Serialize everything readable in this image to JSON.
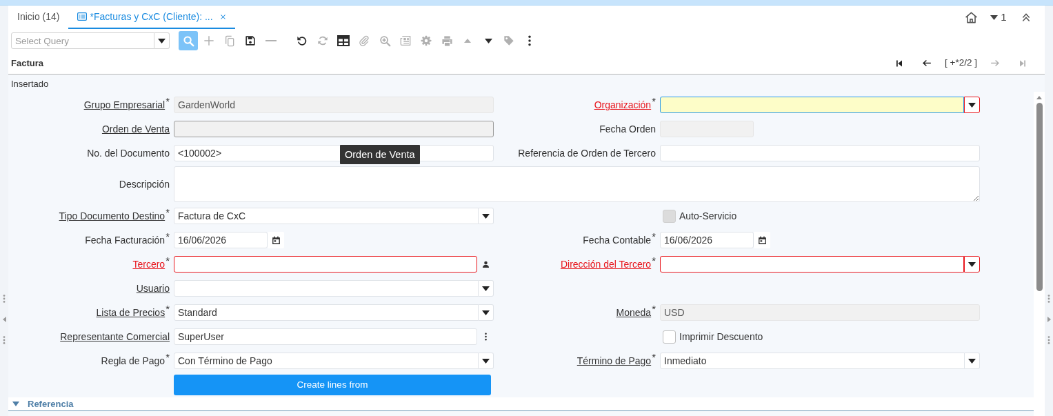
{
  "tabs": [
    {
      "kind": "home",
      "label": "Inicio (14)",
      "selected": false
    },
    {
      "kind": "window",
      "label": "*Facturas y CxC (Cliente): ...",
      "selected": true
    }
  ],
  "window_actions": {
    "count": "1"
  },
  "toolbar": {
    "query": {
      "placeholder": "Select Query"
    },
    "groups": [
      [
        {
          "kind": "search",
          "disabled": false
        },
        {
          "kind": "new",
          "disabled": true
        },
        {
          "kind": "copy",
          "disabled": true
        },
        {
          "kind": "save",
          "disabled": false
        },
        {
          "kind": "delete",
          "disabled": true
        }
      ],
      [
        {
          "kind": "undo",
          "disabled": false
        },
        {
          "kind": "refresh",
          "disabled": true
        },
        {
          "kind": "grid",
          "disabled": false
        },
        {
          "kind": "attachment",
          "disabled": true
        },
        {
          "kind": "zoom",
          "disabled": true
        },
        {
          "kind": "report",
          "disabled": true
        },
        {
          "kind": "settings",
          "disabled": true
        },
        {
          "kind": "print",
          "disabled": true
        },
        {
          "kind": "up",
          "disabled": true
        },
        {
          "kind": "down",
          "disabled": false
        },
        {
          "kind": "tag",
          "disabled": true
        },
        {
          "kind": "more",
          "disabled": false
        }
      ]
    ]
  },
  "panel": {
    "title": "Factura",
    "nav": {
      "back": [
        {
          "kind": "first",
          "disabled": false
        },
        {
          "kind": "previous",
          "disabled": false
        }
      ],
      "position": "[ +*2/2 ]",
      "forward": [
        {
          "kind": "next",
          "disabled": true
        },
        {
          "kind": "last",
          "disabled": true
        }
      ]
    }
  },
  "form": {
    "status": "Insertado",
    "rows": [
      {
        "left": {
          "kind": "text",
          "label": "Grupo Empresarial$^{*}$",
          "link": true,
          "readonly": true,
          "error": false,
          "value": "GardenWorld"
        },
        "right": {
          "kind": "select",
          "label": "Organización$^{*}$",
          "link": true,
          "readonly": false,
          "error": true,
          "focused": true
        }
      },
      {
        "left": {
          "kind": "text",
          "label": "Orden de Venta",
          "link": true,
          "readonly": true,
          "error": false,
          "hovered": true
        },
        "right": {
          "kind": "date",
          "label": "Fecha Orden",
          "link": false,
          "readonly": true,
          "error": false
        }
      },
      {
        "left": {
          "kind": "text",
          "label": "No. del Documento",
          "link": false,
          "readonly": false,
          "error": false,
          "value": "<100002>"
        },
        "right": {
          "kind": "text",
          "label": "Referencia de Orden de Tercero",
          "link": false,
          "readonly": false,
          "error": false
        }
      },
      {
        "left": {
          "kind": "textarea",
          "label": "Descripción",
          "link": false,
          "readonly": false,
          "error": false
        }
      },
      {
        "left": {
          "kind": "select",
          "label": "Tipo Documento Destino$^{*}$",
          "link": true,
          "readonly": false,
          "error": false,
          "value": "Factura de CxC"
        },
        "right": {
          "kind": "checkbox",
          "label": "Auto-Servicio",
          "checked": false,
          "disabled": true
        }
      },
      {
        "left": {
          "kind": "date",
          "label": "Fecha Facturación$^{*}$",
          "link": false,
          "readonly": false,
          "error": false,
          "value": "16/06/2026"
        },
        "right": {
          "kind": "date",
          "label": "Fecha Contable$^{*}$",
          "link": false,
          "readonly": false,
          "error": false,
          "value": "16/06/2026"
        }
      },
      {
        "left": {
          "kind": "search",
          "label": "Tercero$^{*}$",
          "link": true,
          "readonly": false,
          "error": true
        },
        "right": {
          "kind": "select",
          "label": "Dirección del Tercero$^{*}$",
          "link": true,
          "readonly": false,
          "error": true
        }
      },
      {
        "left": {
          "kind": "select",
          "label": "Usuario",
          "link": true,
          "readonly": false,
          "error": false
        }
      },
      {
        "left": {
          "kind": "select",
          "label": "Lista de Precios$^{*}$",
          "link": true,
          "readonly": false,
          "error": false,
          "value": "Standard"
        },
        "right": {
          "kind": "text",
          "label": "Moneda$^{*}$",
          "link": true,
          "readonly": true,
          "error": false,
          "value": "USD"
        }
      },
      {
        "left": {
          "kind": "menu",
          "label": "Representante Comercial",
          "link": true,
          "readonly": false,
          "error": false,
          "value": "SuperUser"
        },
        "right": {
          "kind": "checkbox",
          "label": "Imprimir Descuento",
          "checked": false,
          "disabled": false
        }
      },
      {
        "left": {
          "kind": "select",
          "label": "Regla de Pago$^{*}$",
          "link": false,
          "readonly": false,
          "error": false,
          "value": "Con Término de Pago"
        },
        "right": {
          "kind": "select",
          "label": "Término de Pago$^{*}$",
          "link": true,
          "readonly": false,
          "error": false,
          "value": "Inmediato"
        }
      },
      {
        "left": {
          "kind": "button",
          "label": "Create lines from"
        }
      }
    ],
    "sections": [
      {
        "title": "Referencia",
        "expanded": true
      }
    ]
  },
  "tooltip": {
    "text": "Orden de Venta"
  }
}
